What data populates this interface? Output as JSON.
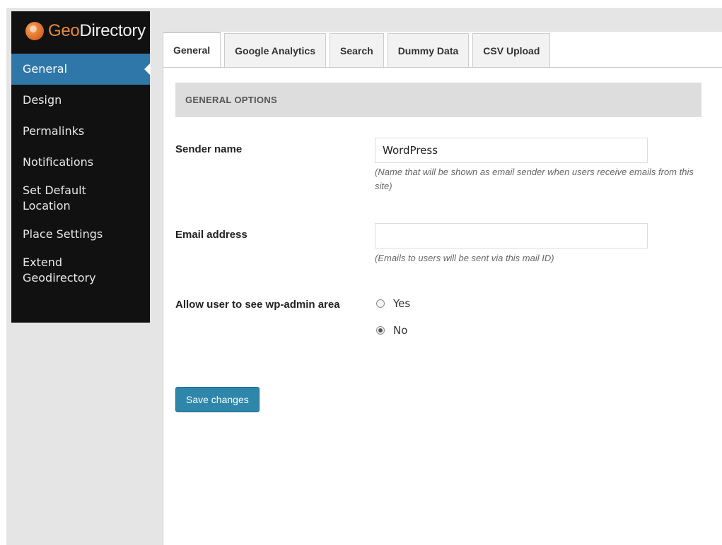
{
  "logo": {
    "prefix": "Geo",
    "suffix": "Directory"
  },
  "sidebar": {
    "items": [
      {
        "label": "General",
        "active": true
      },
      {
        "label": "Design"
      },
      {
        "label": "Permalinks"
      },
      {
        "label": "Notifications"
      },
      {
        "label": "Set Default Location"
      },
      {
        "label": "Place Settings"
      },
      {
        "label": "Extend Geodirectory"
      }
    ]
  },
  "tabs": [
    {
      "label": "General",
      "active": true
    },
    {
      "label": "Google Analytics"
    },
    {
      "label": "Search"
    },
    {
      "label": "Dummy Data"
    },
    {
      "label": "CSV Upload"
    }
  ],
  "section": {
    "title": "GENERAL OPTIONS"
  },
  "fields": {
    "sender_name": {
      "label": "Sender name",
      "value": "WordPress",
      "hint": "(Name that will be shown as email sender when users receive emails from this site)"
    },
    "email": {
      "label": "Email address",
      "value": "",
      "hint": "(Emails to users will be sent via this mail ID)"
    },
    "wp_admin": {
      "label": "Allow user to see wp-admin area",
      "options": [
        "Yes",
        "No"
      ],
      "selected": "No"
    }
  },
  "save_button": {
    "label": "Save changes"
  },
  "colors": {
    "sidebar_bg": "#111111",
    "active_item": "#2e77a8",
    "save_button": "#2e86ab",
    "logo_accent": "#e88a3a"
  }
}
